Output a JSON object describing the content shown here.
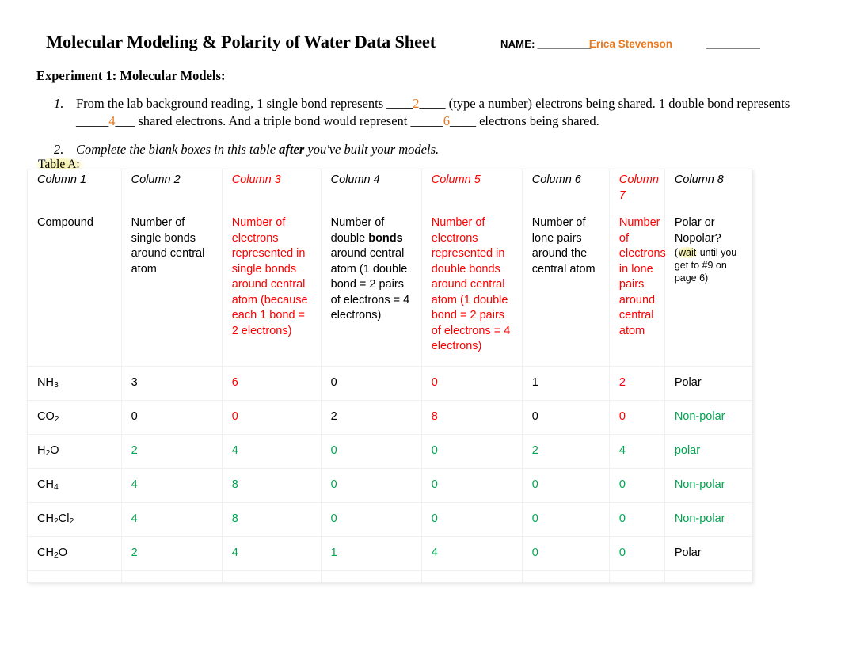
{
  "document": {
    "title": "Molecular Modeling & Polarity of Water Data Sheet",
    "name_label": "NAME:",
    "name_rule": "__________",
    "name_value": "Erica Stevenson",
    "name_rule_2": "__________",
    "experiment_heading": "Experiment 1: Molecular Models:"
  },
  "questions": [
    {
      "number": "1.",
      "part1": "From the lab background reading, 1 single bond represents ",
      "blank1_pre": "____",
      "blank1": "2",
      "blank1_post": "____",
      "part2": " (type a number) electrons being shared. 1 double bond represents ",
      "blank2_pre": "_____",
      "blank2": "4",
      "blank2_post": "___",
      "part3": " shared electrons. And a triple bond would represent ",
      "blank3_pre": "_____",
      "blank3": "6",
      "blank3_post": "____",
      "part4": " electrons being shared."
    },
    {
      "number": "2.",
      "pre": "Complete the blank boxes in this table ",
      "emphasis": "after",
      "post": " you've built your models."
    }
  ],
  "table_a": {
    "label": "Table A:",
    "column_names": [
      "Column 1",
      "Column 2",
      "Column 3",
      "Column 4",
      "Column 5",
      "Column 6",
      "Column 7",
      "Column 8"
    ],
    "column_name_colors": [
      "#000000",
      "#000000",
      "#ff0000",
      "#000000",
      "#ff0000",
      "#000000",
      "#ff0000",
      "#000000"
    ],
    "descriptions": {
      "c1": "Compound",
      "c2": "Number of single bonds around central atom",
      "c3": "Number of electrons represented in single bonds around central atom (because each 1 bond = 2 electrons)",
      "c4_a": "Number of double ",
      "c4_bold": "bonds",
      "c4_b": " around central atom (1 double bond = 2 pairs of electrons = 4 electrons)",
      "c5": "Number of electrons represented in double bonds around central atom (1 double bond = 2 pairs of electrons = 4 electrons)",
      "c6": "Number of lone pairs around the central atom",
      "c7": "Number of electrons in lone pairs around central atom",
      "c8_main": "Polar or Nopolar?",
      "c8_note_pre": "(",
      "c8_note_hl": "wait",
      "c8_note_post": " until you get to #9 on page 6)"
    },
    "rows": [
      {
        "compound": {
          "formula_main": "NH",
          "sub1": "3",
          "formula_mid": "",
          "sub2": ""
        },
        "cells": [
          {
            "value": "3",
            "color": "#000000"
          },
          {
            "value": "6",
            "color": "#ff0000"
          },
          {
            "value": "0",
            "color": "#000000"
          },
          {
            "value": "0",
            "color": "#ff0000"
          },
          {
            "value": "1",
            "color": "#000000"
          },
          {
            "value": "2",
            "color": "#ff0000"
          },
          {
            "value": "Polar",
            "color": "#000000"
          }
        ]
      },
      {
        "compound": {
          "formula_main": "CO",
          "sub1": "2",
          "formula_mid": "",
          "sub2": ""
        },
        "cells": [
          {
            "value": "0",
            "color": "#000000"
          },
          {
            "value": "0",
            "color": "#ff0000"
          },
          {
            "value": "2",
            "color": "#000000"
          },
          {
            "value": "8",
            "color": "#ff0000"
          },
          {
            "value": "0",
            "color": "#000000"
          },
          {
            "value": "0",
            "color": "#ff0000"
          },
          {
            "value": "Non-polar",
            "color": "#00a550"
          }
        ]
      },
      {
        "compound": {
          "formula_main": "H",
          "sub1": "2",
          "formula_mid": "O",
          "sub2": ""
        },
        "cells": [
          {
            "value": "2",
            "color": "#00a550"
          },
          {
            "value": "4",
            "color": "#00a550"
          },
          {
            "value": "0",
            "color": "#00a550"
          },
          {
            "value": "0",
            "color": "#00a550"
          },
          {
            "value": "2",
            "color": "#00a550"
          },
          {
            "value": "4",
            "color": "#00a550"
          },
          {
            "value": "polar",
            "color": "#00a550"
          }
        ]
      },
      {
        "compound": {
          "formula_main": "CH",
          "sub1": "4",
          "formula_mid": "",
          "sub2": ""
        },
        "cells": [
          {
            "value": "4",
            "color": "#00a550"
          },
          {
            "value": "8",
            "color": "#00a550"
          },
          {
            "value": "0",
            "color": "#00a550"
          },
          {
            "value": "0",
            "color": "#00a550"
          },
          {
            "value": "0",
            "color": "#00a550"
          },
          {
            "value": "0",
            "color": "#00a550"
          },
          {
            "value": "Non-polar",
            "color": "#00a550"
          }
        ]
      },
      {
        "compound": {
          "formula_main": "CH",
          "sub1": "2",
          "formula_mid": "Cl",
          "sub2": "2"
        },
        "cells": [
          {
            "value": "4",
            "color": "#00a550"
          },
          {
            "value": "8",
            "color": "#00a550"
          },
          {
            "value": "0",
            "color": "#00a550"
          },
          {
            "value": "0",
            "color": "#00a550"
          },
          {
            "value": "0",
            "color": "#00a550"
          },
          {
            "value": "0",
            "color": "#00a550"
          },
          {
            "value": "Non-polar",
            "color": "#00a550"
          }
        ]
      },
      {
        "compound": {
          "formula_main": "CH",
          "sub1": "2",
          "formula_mid": "O",
          "sub2": ""
        },
        "cells": [
          {
            "value": "2",
            "color": "#00a550"
          },
          {
            "value": "4",
            "color": "#00a550"
          },
          {
            "value": "1",
            "color": "#00a550"
          },
          {
            "value": "4",
            "color": "#00a550"
          },
          {
            "value": "0",
            "color": "#00a550"
          },
          {
            "value": "0",
            "color": "#00a550"
          },
          {
            "value": "Polar",
            "color": "#000000"
          }
        ]
      }
    ]
  },
  "colors": {
    "red": "#ff0000",
    "green": "#00a550",
    "orange": "#e8791e",
    "highlight": "#f4ef93"
  }
}
